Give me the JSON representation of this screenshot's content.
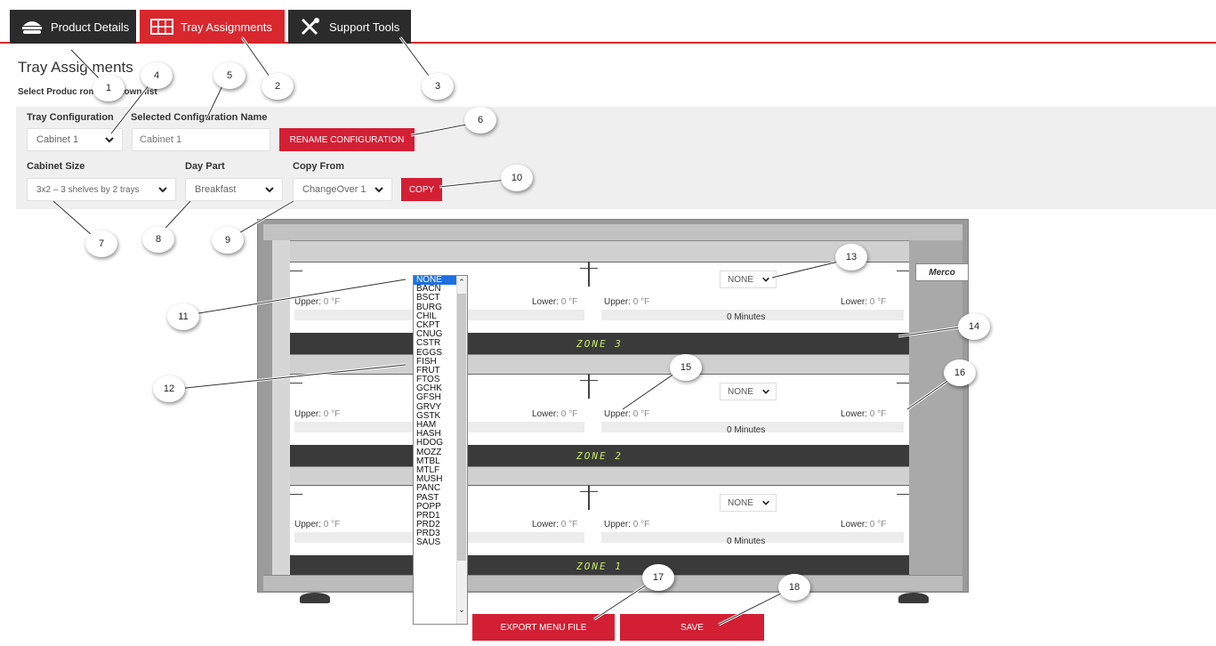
{
  "tabs": [
    {
      "label": "Product Details",
      "icon": "burger-icon"
    },
    {
      "label": "Tray Assignments",
      "icon": "tray-grid-icon"
    },
    {
      "label": "Support Tools",
      "icon": "tools-icon"
    }
  ],
  "page": {
    "title": "Tray Assig  ments",
    "subtitle": "Select Produc       rom dropdown list"
  },
  "config": {
    "tray_configuration_label": "Tray Configuration",
    "tray_configuration_value": "Cabinet 1",
    "selected_name_label": "Selected Configuration Name",
    "selected_name_value": "Cabinet 1",
    "rename_button": "RENAME CONFIGURATION",
    "cabinet_size_label": "Cabinet Size",
    "cabinet_size_value": "3x2 – 3 shelves by 2 trays",
    "day_part_label": "Day Part",
    "day_part_value": "Breakfast",
    "copy_from_label": "Copy From",
    "copy_from_value": "ChangeOver 1",
    "copy_button": "COPY"
  },
  "cabinet": {
    "brand": "Merco",
    "upper_label": "Upper:",
    "lower_label": "Lower:",
    "temp_value": "0 °F",
    "minutes_text": "0 Minutes",
    "tray_select_value": "NONE",
    "zones": [
      "ZONE 3",
      "ZONE 2",
      "ZONE 1"
    ]
  },
  "dropdown": {
    "selected": "NONE",
    "options": [
      "NONE",
      "BACN",
      "BSCT",
      "BURG",
      "CHIL",
      "CKPT",
      "CNUG",
      "CSTR",
      "EGGS",
      "FISH",
      "FRUT",
      "FTOS",
      "GCHK",
      "GFSH",
      "GRVY",
      "GSTK",
      "HAM",
      "HASH",
      "HDOG",
      "MOZZ",
      "MTBL",
      "MTLF",
      "MUSH",
      "PANC",
      "PAST",
      "POPP",
      "PRD1",
      "PRD2",
      "PRD3",
      "SAUS"
    ]
  },
  "buttons": {
    "export": "EXPORT MENU FILE",
    "save": "SAVE"
  },
  "callouts": [
    "1",
    "2",
    "3",
    "4",
    "5",
    "6",
    "7",
    "8",
    "9",
    "10",
    "11",
    "12",
    "13",
    "14",
    "15",
    "16",
    "17",
    "18"
  ],
  "colors": {
    "accent_red": "#d9272e",
    "tab_dark": "#2b2b2b",
    "zone_text": "#c7e86a",
    "dropdown_selected": "#1e6fe0"
  }
}
